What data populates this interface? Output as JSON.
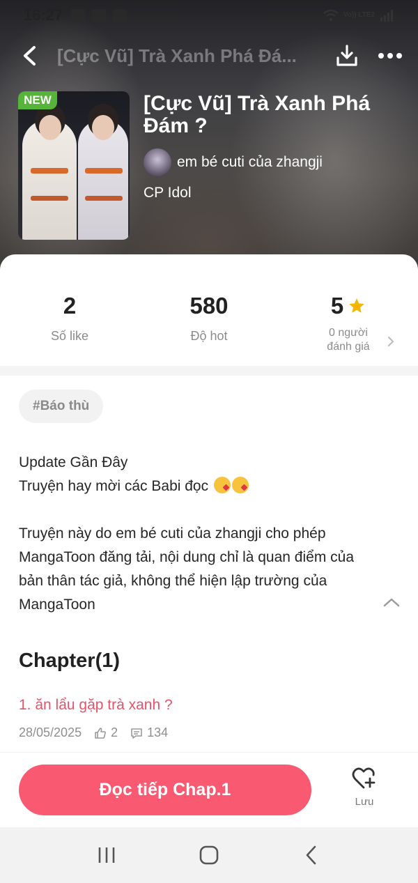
{
  "status_bar": {
    "time": "16:27",
    "network": "Vo)) LTE2"
  },
  "top_nav": {
    "title": "[Cực Vũ] Trà Xanh Phá Đá..."
  },
  "book": {
    "badge": "NEW",
    "title": "[Cực Vũ] Trà Xanh Phá Đám ?",
    "author": "em bé cuti của zhangji",
    "genre": "CP Idol"
  },
  "stats": {
    "likes": {
      "value": "2",
      "label": "Số like"
    },
    "hot": {
      "value": "580",
      "label": "Độ hot"
    },
    "rating": {
      "value": "5",
      "label_line1": "0 người",
      "label_line2": "đánh giá"
    }
  },
  "tag": "#Báo thù",
  "description": {
    "line1": "Update Gần Đây",
    "line2": "Truyện hay mời các Babi đọc",
    "notice": "Truyện này do em bé cuti của zhangji cho phép MangaToon đăng tải, nội dung chỉ là quan điểm của bản thân tác giả, không thể hiện lập trường của MangaToon"
  },
  "chapters": {
    "heading": "Chapter(1)",
    "items": [
      {
        "title": "1. ăn lẩu gặp trà xanh ?",
        "date": "28/05/2025",
        "likes": "2",
        "comments": "134"
      }
    ]
  },
  "actions": {
    "read_button": "Đọc tiếp Chap.1",
    "save_label": "Lưu"
  },
  "colors": {
    "accent": "#f95a72",
    "chapter_link": "#e9506a",
    "star": "#f5b400",
    "new_badge": "#56b43a"
  }
}
